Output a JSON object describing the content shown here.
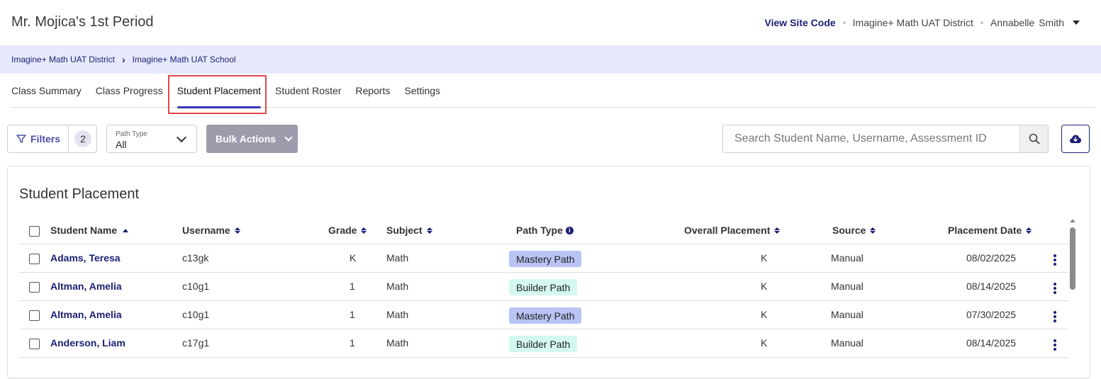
{
  "header": {
    "title": "Mr. Mojica's 1st Period",
    "view_site_code": "View Site Code",
    "district": "Imagine+ Math UAT District",
    "user_first": "Annabelle",
    "user_last": "Smith"
  },
  "breadcrumb": {
    "items": [
      "Imagine+ Math UAT District",
      "Imagine+ Math UAT School"
    ]
  },
  "tabs": [
    {
      "label": "Class Summary"
    },
    {
      "label": "Class Progress"
    },
    {
      "label": "Student Placement",
      "active": true
    },
    {
      "label": "Student Roster"
    },
    {
      "label": "Reports"
    },
    {
      "label": "Settings"
    }
  ],
  "toolbar": {
    "filters_label": "Filters",
    "filters_count": "2",
    "path_type_label": "Path Type",
    "path_type_value": "All",
    "bulk_actions_label": "Bulk Actions",
    "search_placeholder": "Search Student Name, Username, Assessment ID"
  },
  "table": {
    "title": "Student Placement",
    "columns": {
      "student_name": "Student Name",
      "username": "Username",
      "grade": "Grade",
      "subject": "Subject",
      "path_type": "Path Type",
      "overall_placement": "Overall Placement",
      "source": "Source",
      "placement_date": "Placement Date"
    },
    "rows": [
      {
        "name": "Adams, Teresa",
        "username": "c13gk",
        "grade": "K",
        "subject": "Math",
        "path_type": "Mastery Path",
        "placement": "K",
        "source": "Manual",
        "date": "08/02/2025"
      },
      {
        "name": "Altman, Amelia",
        "username": "c10g1",
        "grade": "1",
        "subject": "Math",
        "path_type": "Builder Path",
        "placement": "K",
        "source": "Manual",
        "date": "08/14/2025"
      },
      {
        "name": "Altman, Amelia",
        "username": "c10g1",
        "grade": "1",
        "subject": "Math",
        "path_type": "Mastery Path",
        "placement": "K",
        "source": "Manual",
        "date": "07/30/2025"
      },
      {
        "name": "Anderson, Liam",
        "username": "c17g1",
        "grade": "1",
        "subject": "Math",
        "path_type": "Builder Path",
        "placement": "K",
        "source": "Manual",
        "date": "08/14/2025"
      }
    ]
  },
  "colors": {
    "brand_navy": "#1b1f73",
    "breadcrumb_bg": "#e6e9fb",
    "mastery_badge": "#b9c4f4",
    "builder_badge": "#d4f8ef",
    "bulk_button": "#9c9cac",
    "active_tab_underline": "#3b36b6",
    "highlight_box": "#e04848"
  }
}
